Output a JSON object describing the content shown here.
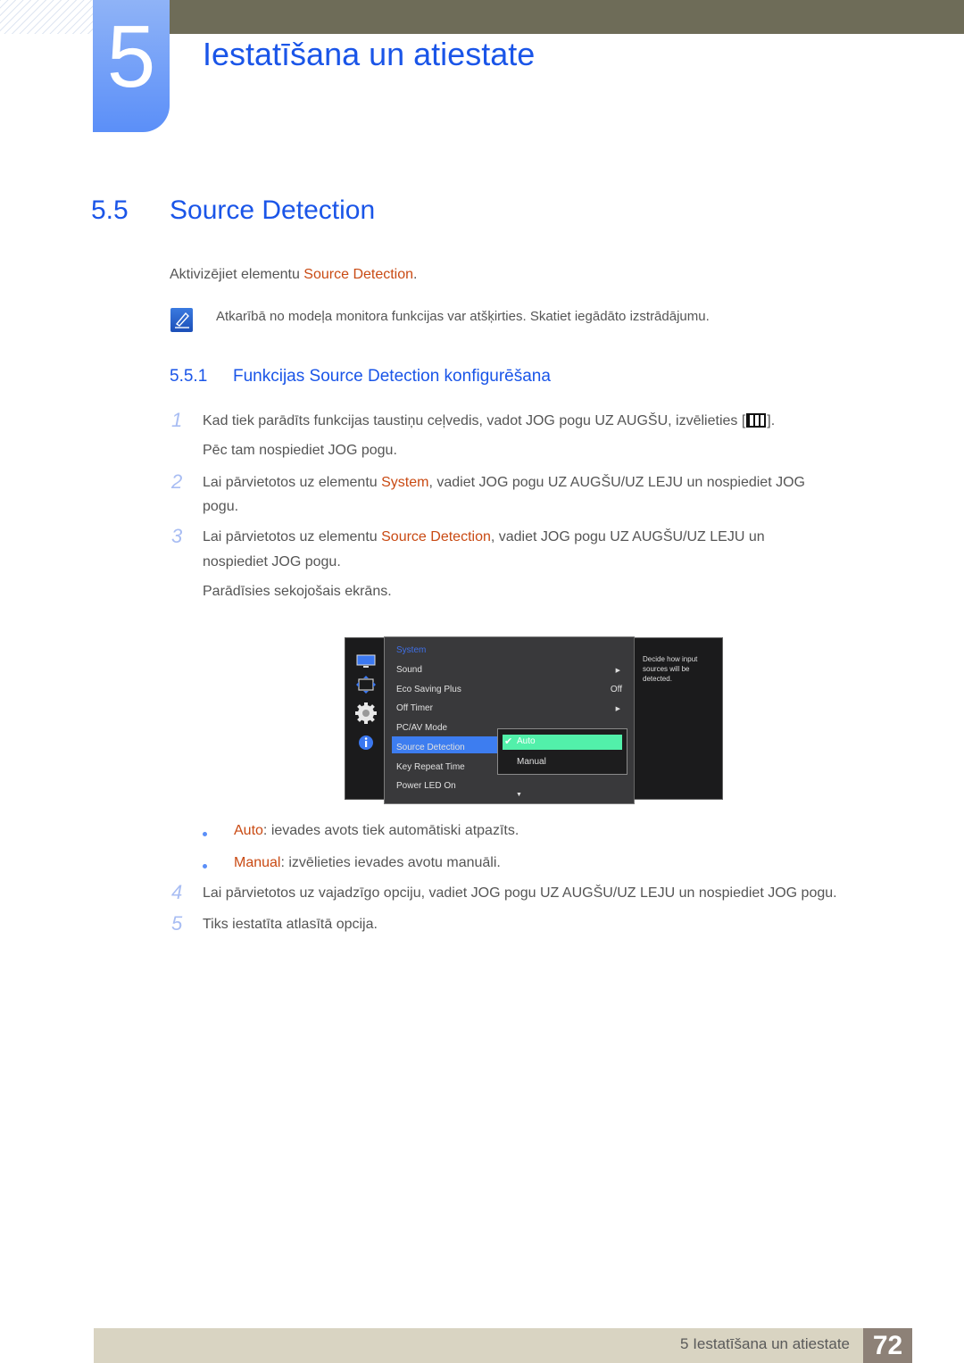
{
  "chapter": {
    "number": "5",
    "title": "Iestatīšana un atiestate"
  },
  "section": {
    "number": "5.5",
    "title": "Source Detection"
  },
  "intro": {
    "prefix": "Aktivizējiet elementu ",
    "highlight": "Source Detection",
    "suffix": "."
  },
  "note": {
    "icon": "note-pencil-icon",
    "text": "Atkarībā no modeļa monitora funkcijas var atšķirties. Skatiet iegādāto izstrādājumu."
  },
  "subsection": {
    "number": "5.5.1",
    "title": "Funkcijas Source Detection konfigurēšana"
  },
  "steps": [
    {
      "num": "1",
      "line1_prefix": "Kad tiek parādīts funkcijas taustiņu ceļvedis, vadot JOG pogu UZ AUGŠU, izvēlieties [",
      "line1_suffix": "].",
      "line2": "Pēc tam nospiediet JOG pogu."
    },
    {
      "num": "2",
      "prefix": "Lai pārvietotos uz elementu ",
      "highlight": "System",
      "suffix": ", vadiet JOG pogu UZ AUGŠU/UZ LEJU un nospiediet JOG",
      "line2": "pogu."
    },
    {
      "num": "3",
      "prefix": "Lai pārvietotos uz elementu ",
      "highlight": "Source Detection",
      "suffix": ", vadiet JOG pogu UZ AUGŠU/UZ LEJU un",
      "line2": "nospiediet JOG pogu.",
      "line3": "Parādīsies sekojošais ekrāns."
    },
    {
      "num": "4",
      "text": "Lai pārvietotos uz vajadzīgo opciju, vadiet JOG pogu UZ AUGŠU/UZ LEJU un nospiediet JOG pogu."
    },
    {
      "num": "5",
      "text": "Tiks iestatīta atlasītā opcija."
    }
  ],
  "osd": {
    "header": "System",
    "items": [
      {
        "label": "Sound",
        "value": "▶"
      },
      {
        "label": "Eco Saving Plus",
        "value": "Off"
      },
      {
        "label": "Off Timer",
        "value": "▶"
      },
      {
        "label": "PC/AV Mode",
        "value": ""
      },
      {
        "label": "Source Detection",
        "value": "",
        "selected": true
      },
      {
        "label": "Key Repeat Time",
        "value": ""
      },
      {
        "label": "Power LED On",
        "value": ""
      }
    ],
    "more_arrow": "▼",
    "submenu": [
      {
        "label": "Auto",
        "checked": true
      },
      {
        "label": "Manual",
        "checked": false
      }
    ],
    "check": "✔",
    "help": "Decide how input sources will be detected.",
    "side_icons": [
      "picture-icon",
      "onscreen-display-icon",
      "system-gear-icon",
      "information-icon"
    ]
  },
  "options": [
    {
      "name": "Auto",
      "desc": ": ievades avots tiek automātiski atpazīts."
    },
    {
      "name": "Manual",
      "desc": ": izvēlieties ievades avotu manuāli."
    }
  ],
  "footer": {
    "text": "5 Iestatīšana un atiestate",
    "page": "72"
  }
}
